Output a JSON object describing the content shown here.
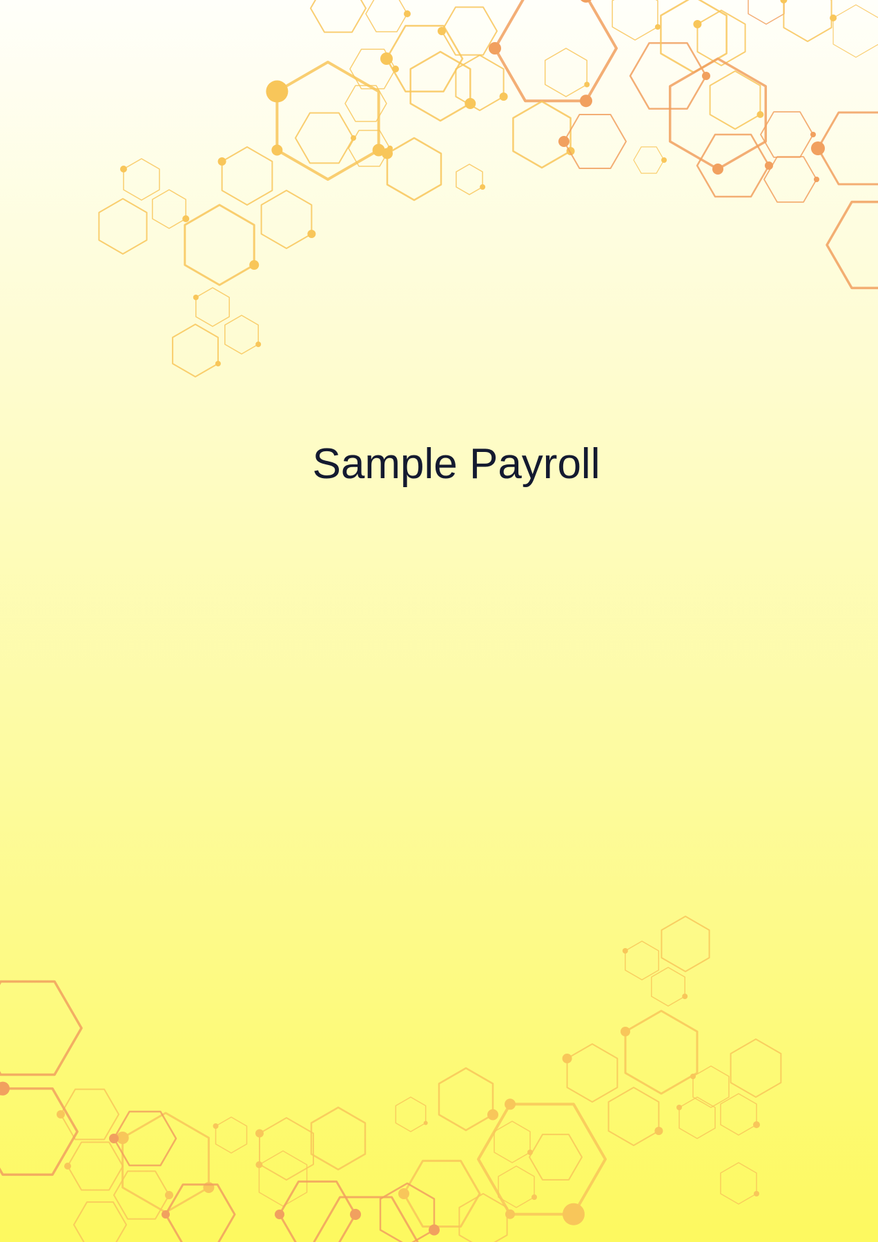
{
  "document": {
    "title": "Sample Payroll"
  },
  "colors": {
    "title_text": "#141a30",
    "hex_gold": "#f8c65a",
    "hex_orange": "#f1a05f",
    "background_top": "#fffffa",
    "background_bottom": "#fdf95f"
  },
  "decor": {
    "top_cluster": "hexagon-network",
    "bottom_cluster": "hexagon-network"
  }
}
